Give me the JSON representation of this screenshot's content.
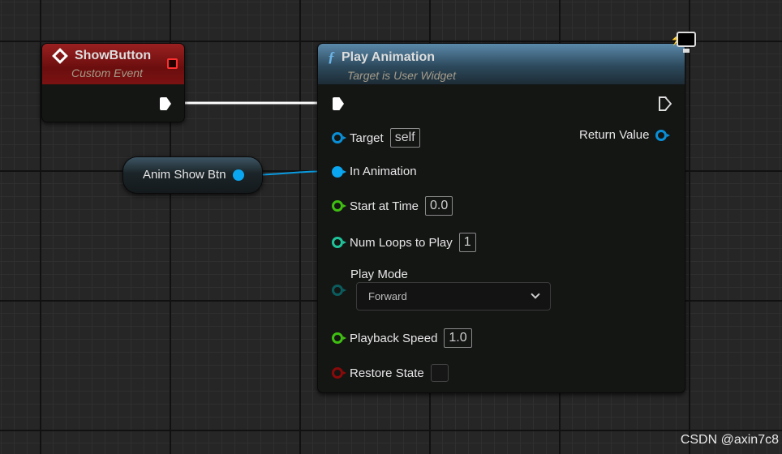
{
  "event_node": {
    "title": "ShowButton",
    "subtitle": "Custom Event",
    "icon": "event-diamond-icon",
    "color": "#8c1515"
  },
  "variable_node": {
    "label": "Anim Show Btn"
  },
  "function_node": {
    "title": "Play Animation",
    "subtitle": "Target is User Widget",
    "icon": "function-icon",
    "color": "#4c7a9c",
    "pins": {
      "target": {
        "label": "Target",
        "value": "self"
      },
      "return_value": "Return Value",
      "in_animation": "In Animation",
      "start_at_time": {
        "label": "Start at Time",
        "value": "0.0"
      },
      "num_loops": {
        "label": "Num Loops to Play",
        "value": "1"
      },
      "play_mode": {
        "label": "Play Mode",
        "value": "Forward"
      },
      "playback_speed": {
        "label": "Playback Speed",
        "value": "1.0"
      },
      "restore_state": {
        "label": "Restore State",
        "checked": false
      }
    }
  },
  "watermark": "CSDN @axin7c8"
}
